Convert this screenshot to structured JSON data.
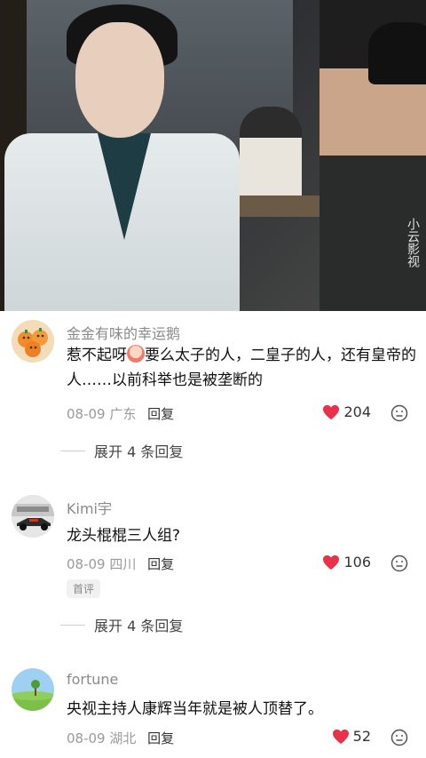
{
  "video": {
    "watermark": "小云影视"
  },
  "comments": [
    {
      "username": "金金有味的幸运鹅",
      "text_before_emoji": "惹不起呀",
      "text_after_emoji": "要么太子的人，二皇子的人，还有皇帝的人……以前科举也是被垄断的",
      "date": "08-09",
      "location": "广东",
      "reply_label": "回复",
      "likes": "204",
      "avatar": "oranges-avatar",
      "expand_label": "展开 4 条回复"
    },
    {
      "username": "Kimi宇",
      "text": "龙头棍棍三人组?",
      "date": "08-09",
      "location": "四川",
      "reply_label": "回复",
      "likes": "106",
      "badge": "首评",
      "avatar": "racecar-avatar",
      "expand_label": "展开 4 条回复"
    },
    {
      "username": "fortune",
      "text": "央视主持人康辉当年就是被人顶替了。",
      "date": "08-09",
      "location": "湖北",
      "reply_label": "回复",
      "likes": "52",
      "avatar": "landscape-avatar"
    }
  ],
  "colors": {
    "heart": "#e8324a",
    "meta": "#9a9a9a",
    "username": "#8a8a8a"
  }
}
